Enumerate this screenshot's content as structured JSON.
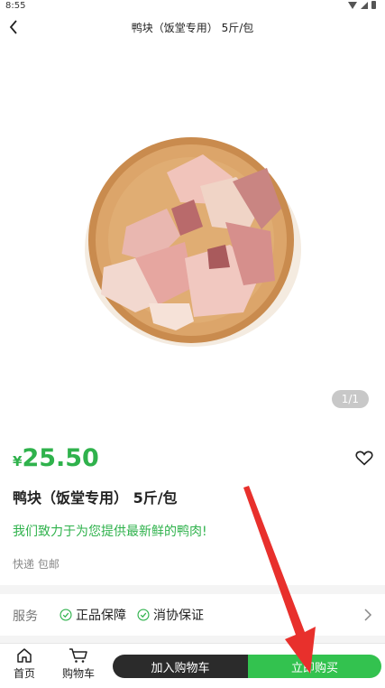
{
  "status_bar": {
    "time": "8:55"
  },
  "nav": {
    "title": "鸭块（饭堂专用） 5斤/包"
  },
  "gallery": {
    "counter": "1/1"
  },
  "product": {
    "price_symbol": "¥",
    "price": "25.50",
    "name": "鸭块（饭堂专用） 5斤/包",
    "slogan": "我们致力于为您提供最新鲜的鸭肉!",
    "shipping": "快递 包邮"
  },
  "service": {
    "label": "服务",
    "items": [
      "正品保障",
      "消协保证"
    ]
  },
  "bottom_bar": {
    "home_label": "首页",
    "cart_label": "购物车",
    "add_cart_label": "加入购物车",
    "buy_now_label": "立即购买"
  },
  "colors": {
    "accent": "#2fb24c",
    "buy_button": "#33c24f",
    "add_button": "#2b2b2b",
    "annotation_arrow": "#e8302c"
  }
}
